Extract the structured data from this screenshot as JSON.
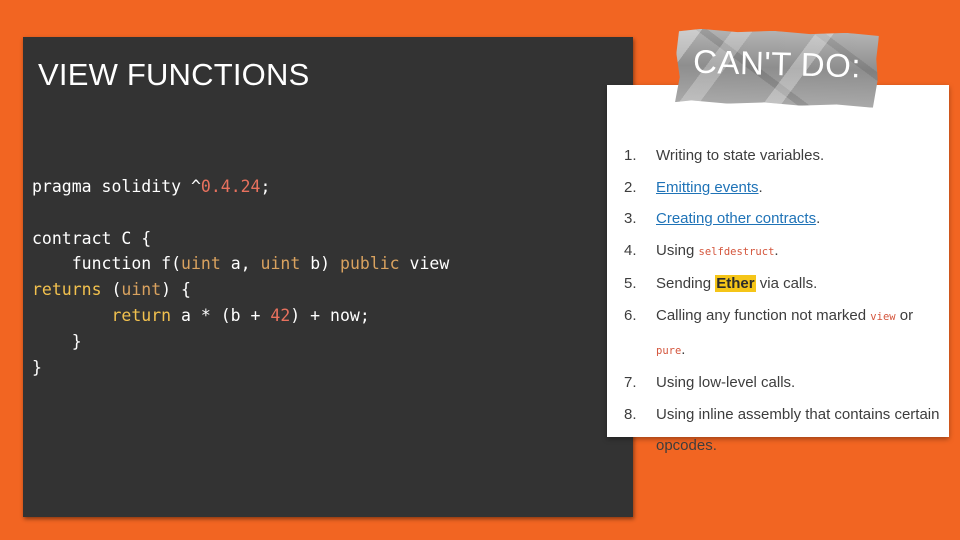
{
  "slide": {
    "title": "VIEW FUNCTIONS"
  },
  "code": {
    "l1_a": "pragma solidity ^",
    "l1_ver": "0.4.24",
    "l1_b": ";",
    "l2": "contract C {",
    "l3_a": "    function f(",
    "l3_ty1": "uint",
    "l3_b": " a, ",
    "l3_ty2": "uint",
    "l3_c": " b) ",
    "l3_kw": "public",
    "l3_d": " view",
    "l4_kw": "returns",
    "l4_a": " (",
    "l4_ty": "uint",
    "l4_b": ") {",
    "l5_kw": "        return",
    "l5_a": " a * (b + ",
    "l5_num": "42",
    "l5_b": ") + now;",
    "l6": "    }",
    "l7": "}"
  },
  "cant_do": {
    "label": "CAN'T DO:",
    "items": [
      {
        "num": "1.",
        "text": "Writing to state variables."
      },
      {
        "num": "2.",
        "link": "Emitting events",
        "after": "."
      },
      {
        "num": "3.",
        "link": "Creating other contracts",
        "after": "."
      },
      {
        "num": "4.",
        "before": "Using ",
        "code": "selfdestruct",
        "after": "."
      },
      {
        "num": "5.",
        "before": "Sending ",
        "highlight": "Ether",
        "after": " via calls."
      },
      {
        "num": "6.",
        "before": "Calling any function not marked ",
        "code": "view",
        "mid": " or ",
        "code2": "pure",
        "after": "."
      },
      {
        "num": "7.",
        "text": "Using low-level calls."
      },
      {
        "num": "8.",
        "text": "Using inline assembly that contains certain opcodes."
      }
    ]
  },
  "colors": {
    "background": "#f26522",
    "code_panel": "#333333",
    "number": "#e8715e",
    "keyword": "#f2c14e",
    "link": "#1f73b7",
    "highlight": "#f5c518"
  }
}
